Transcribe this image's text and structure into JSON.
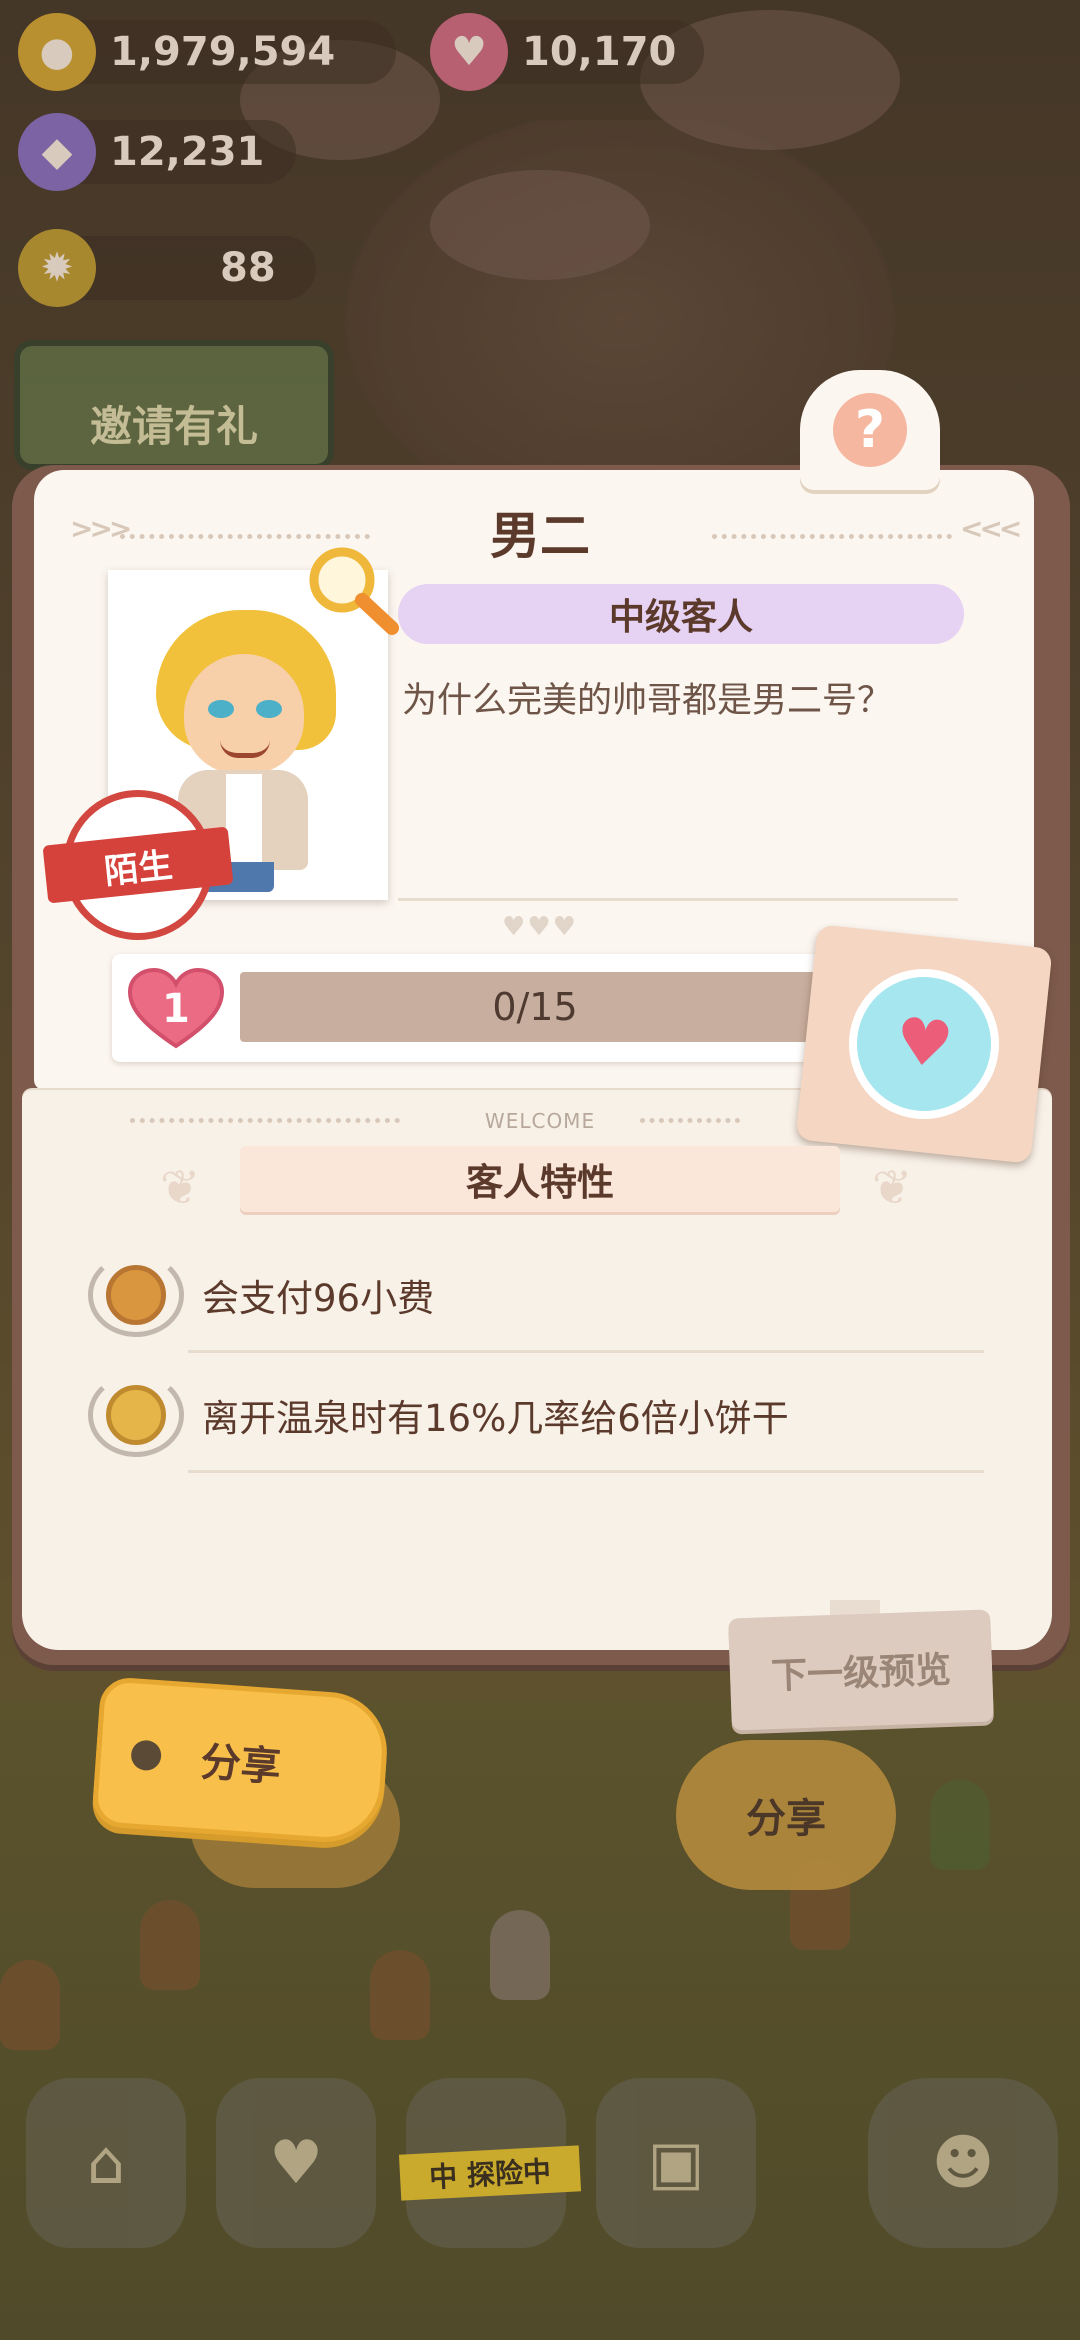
{
  "resources": {
    "cookies": "1,979,594",
    "cakes": "10,170",
    "gems": "12,231",
    "level": "88"
  },
  "invite_label": "邀请有礼",
  "customer": {
    "name": "男二",
    "rank": "中级客人",
    "quote": "为什么完美的帅哥都是男二号？",
    "relationship": "陌生",
    "heart_level": "1",
    "affection_text": "0/15",
    "affection_current": 0,
    "affection_max": 15
  },
  "traits_section": {
    "welcome_label": "WELCOME",
    "title": "客人特性",
    "items": [
      {
        "icon": "cookie-coin-icon",
        "text": "会支付96小费"
      },
      {
        "icon": "cookie-cup-icon",
        "text": "离开温泉时有16%几率给6倍小饼干"
      }
    ]
  },
  "buttons": {
    "next_level_preview": "下一级预览",
    "share": "分享",
    "share_secondary": "分享"
  },
  "dock": {
    "adventure_tape": "中 探险中"
  },
  "colors": {
    "page": "#fbf6f0",
    "book_border": "#7d5a4c",
    "rank_banner": "#e6d2f2",
    "share_tag": "#f8c04a",
    "stamp_red": "#d5423b"
  }
}
